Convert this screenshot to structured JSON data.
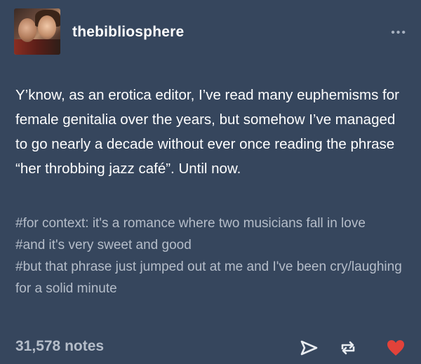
{
  "post": {
    "username": "thebibliosphere",
    "more_label": "•••",
    "body": "Y’know, as an erotica editor, I’ve read many euphemisms for female genitalia over the years, but somehow I’ve managed to go nearly a decade without ever once reading the phrase “her throbbing jazz café”. Until now.",
    "tags": [
      "#for context: it's a romance where two musicians fall in love",
      "#and it's very sweet and good",
      "#but that phrase just jumped out at me and I've been cry/laughing for a solid minute"
    ],
    "notes": "31,578 notes"
  },
  "icons": {
    "share": "share-icon",
    "reblog": "reblog-icon",
    "like": "heart-icon",
    "more": "more-icon"
  },
  "colors": {
    "background": "#36465d",
    "text": "#ffffff",
    "muted": "#b5bdc9",
    "like": "#e2423a"
  }
}
